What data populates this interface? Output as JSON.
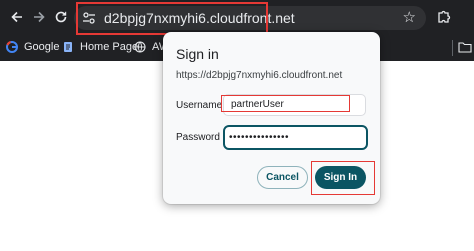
{
  "browser": {
    "url": "d2bpjg7nxmyhi6.cloudfront.net",
    "icons": {
      "back": "back-arrow-icon",
      "forward": "forward-arrow-icon",
      "reload": "reload-icon",
      "site_info": "site-info-icon",
      "bookmark": "star-icon",
      "extensions": "puzzle-icon"
    },
    "bookmarks": [
      {
        "label": "Google",
        "icon": "google-icon"
      },
      {
        "label": "Home Page",
        "icon": "page-icon"
      },
      {
        "label": "AW",
        "icon": "globe-icon"
      }
    ]
  },
  "dialog": {
    "title": "Sign in",
    "site": "https://d2bpjg7nxmyhi6.cloudfront.net",
    "username_label": "Username",
    "username_value": "partnerUser",
    "password_label": "Password",
    "password_value": "•••••••••••••••",
    "cancel_label": "Cancel",
    "signin_label": "Sign In"
  },
  "colors": {
    "chrome_bg": "#202124",
    "accent": "#0b5563",
    "highlight": "#e53935"
  }
}
